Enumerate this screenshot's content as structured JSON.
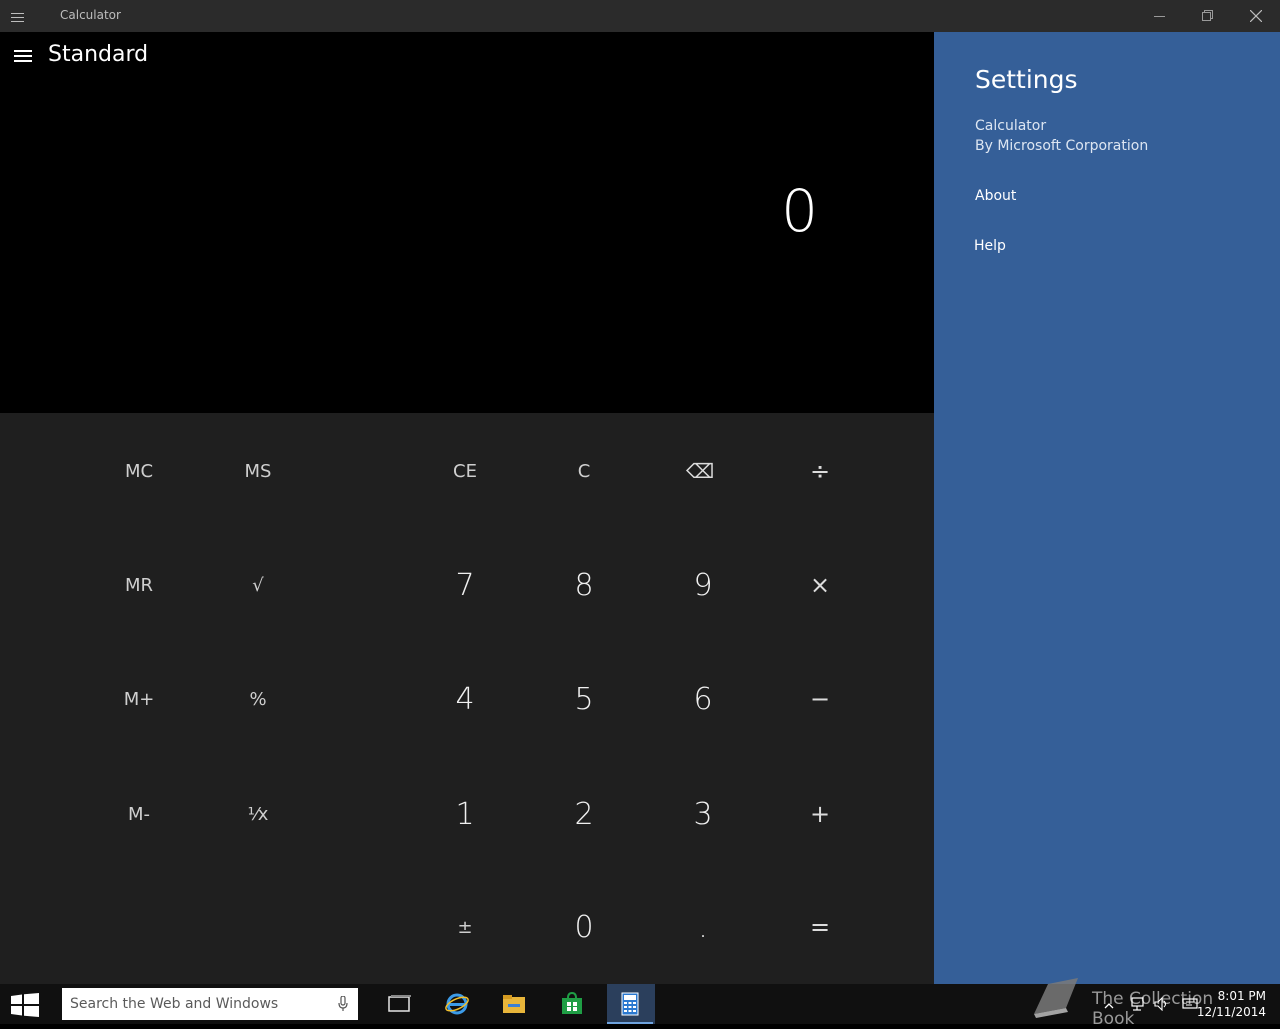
{
  "window": {
    "title": "Calculator"
  },
  "calculator": {
    "mode": "Standard",
    "display": "0",
    "keys": {
      "mc": "MC",
      "ms": "MS",
      "mr": "MR",
      "mplus": "M+",
      "mminus": "M-",
      "sqrt": "√",
      "percent": "%",
      "reciprocal": "⅟x",
      "ce": "CE",
      "c": "C",
      "backspace": "⌫",
      "divide": "÷",
      "multiply": "×",
      "minus": "−",
      "plus": "+",
      "equals": "=",
      "seven": "7",
      "eight": "8",
      "nine": "9",
      "four": "4",
      "five": "5",
      "six": "6",
      "one": "1",
      "two": "2",
      "three": "3",
      "negate": "±",
      "zero": "0",
      "decimal": "."
    }
  },
  "settings": {
    "title": "Settings",
    "app_name": "Calculator",
    "publisher": "By Microsoft Corporation",
    "about": "About",
    "help": "Help"
  },
  "taskbar": {
    "search_placeholder": "Search the Web and Windows",
    "apps": [
      "task-view-icon",
      "internet-explorer-icon",
      "file-explorer-icon",
      "store-icon",
      "calculator-icon"
    ],
    "watermark": "The Collection Book",
    "time": "8:01 PM",
    "date": "12/11/2014"
  },
  "colors": {
    "settings_bg": "#355f98",
    "keypad_bg": "#1f1f1f",
    "display_bg": "#000000",
    "titlebar_bg": "#2b2b2b"
  }
}
